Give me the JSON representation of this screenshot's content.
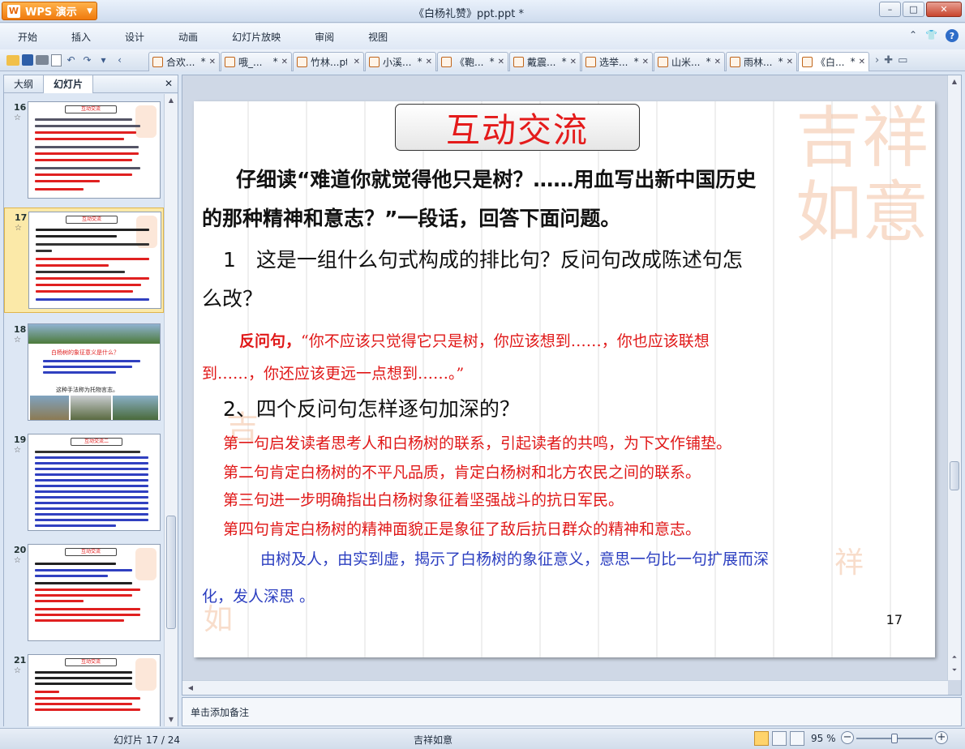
{
  "app": {
    "name": "WPS 演示",
    "logo_letter": "W",
    "document_title": "《白杨礼赞》ppt.ppt *",
    "window_controls": [
      "minimize",
      "maximize",
      "close"
    ]
  },
  "menu": [
    "开始",
    "插入",
    "设计",
    "动画",
    "幻灯片放映",
    "审阅",
    "视图"
  ],
  "doc_tabs": [
    {
      "label": "合欢...",
      "dirty": "*"
    },
    {
      "label": "哦_...",
      "dirty": "*"
    },
    {
      "label": "竹林...pt",
      "dirty": ""
    },
    {
      "label": "小溪...",
      "dirty": "*"
    },
    {
      "label": "《鞄...",
      "dirty": "*"
    },
    {
      "label": "戴震...",
      "dirty": "*"
    },
    {
      "label": "选举...",
      "dirty": "*"
    },
    {
      "label": "山米...",
      "dirty": "*"
    },
    {
      "label": "雨林...",
      "dirty": "*"
    },
    {
      "label": "《白...",
      "dirty": "*"
    }
  ],
  "left_panel": {
    "tabs": [
      "大纲",
      "幻灯片"
    ],
    "active_tab": "幻灯片",
    "thumbnails": [
      {
        "number": "16",
        "title": "互动交流"
      },
      {
        "number": "17",
        "title": "互动交流",
        "selected": true
      },
      {
        "number": "18",
        "title": "",
        "caption_line1": "白杨树的象征意义是什么？",
        "caption_line2": "这种手法称为托物言志。"
      },
      {
        "number": "19",
        "title": "互动交流二"
      },
      {
        "number": "20",
        "title": "互动交流"
      },
      {
        "number": "21",
        "title": "互动交流"
      }
    ]
  },
  "slide": {
    "title": "互动交流",
    "intro": [
      "仔细读“难道你就觉得他只是树？……用血写出新中国历史",
      "的那种精神和意志？”一段话，回答下面问题。"
    ],
    "q1": [
      "1　这是一组什么句式构成的排比句？反问句改成陈述句怎",
      "么改？"
    ],
    "a1_label": "反问句，",
    "a1": [
      "“你不应该只觉得它只是树，你应该想到……，你也应该联想",
      "到……，你还应该更远一点想到……。”"
    ],
    "q2": "2、四个反问句怎样逐句加深的？",
    "a2": [
      "第一句启发读者思考人和白杨树的联系，引起读者的共鸣，为下文作铺垫。",
      "第二句肯定白杨树的不平凡品质，肯定白杨树和北方农民之间的联系。",
      "第三句进一步明确指出白杨树象征着坚强战斗的抗日军民。",
      "第四句肯定白杨树的精神面貌正是象征了敌后抗日群众的精神和意志。"
    ],
    "summary": [
      "由树及人，由实到虚，揭示了白杨树的象征意义，意思一句比一句扩展而深",
      "化，发人深思 。"
    ],
    "page_number": "17",
    "decoration": "吉祥如意"
  },
  "notes_placeholder": "单击添加备注",
  "status": {
    "slide_info": "幻灯片 17 / 24",
    "theme": "吉祥如意",
    "zoom": "95 %",
    "zoom_level": 0.5
  },
  "colors": {
    "title_red": "#e41b1b",
    "answer_red": "#e01818",
    "summary_blue": "#2b3ec0",
    "wps_orange": "#f07a0d"
  }
}
